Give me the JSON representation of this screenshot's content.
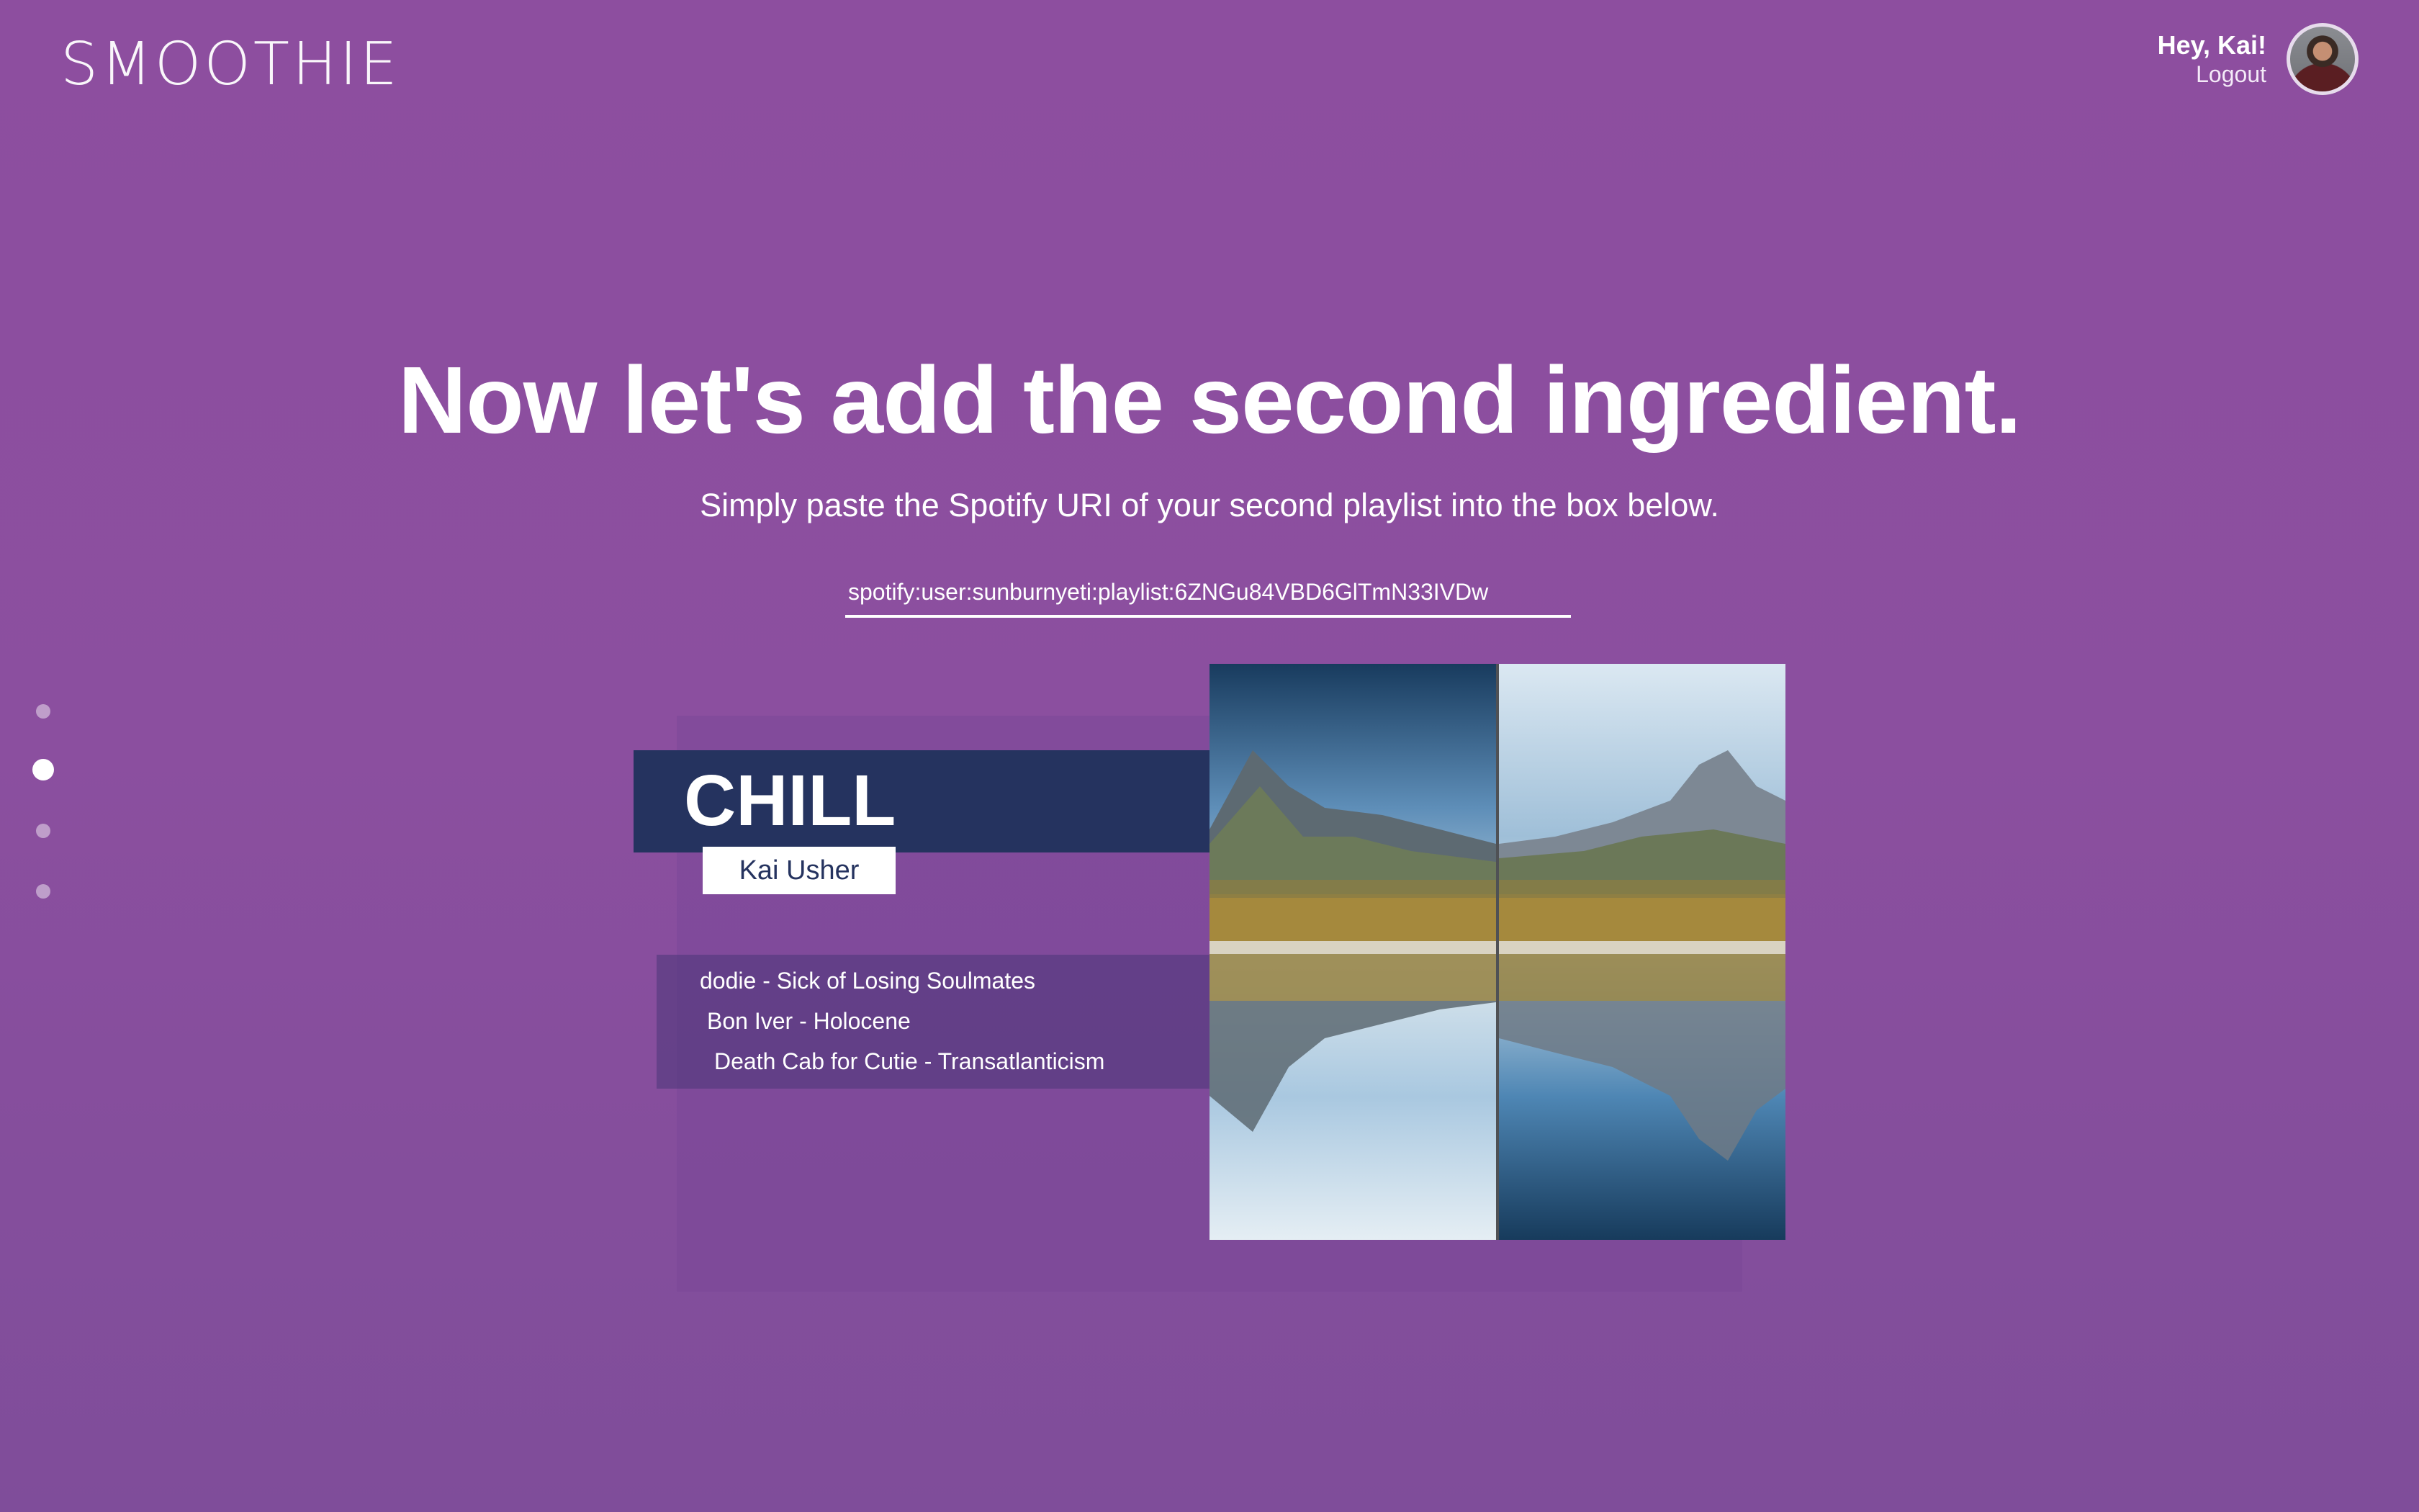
{
  "header": {
    "logo": "SMOOTHIE",
    "greeting": "Hey, Kai!",
    "logout_label": "Logout"
  },
  "main": {
    "heading": "Now let's add the second ingredient.",
    "subheading": "Simply paste the Spotify URI of your second playlist into the box below.",
    "uri_value": "spotify:user:sunburnyeti:playlist:6ZNGu84VBD6GlTmN33IVDw"
  },
  "steps": {
    "total": 4,
    "active_index": 1
  },
  "playlist": {
    "title": "CHILL",
    "owner": "Kai Usher",
    "tracks": [
      "dodie - Sick of Losing Soulmates",
      "Bon Iver - Holocene",
      "Death Cab for Cutie - Transatlanticism"
    ],
    "cover_icon": "mirrored-mountain-lake-image"
  },
  "colors": {
    "background": "#8b4f9f",
    "title_band": "#25335f",
    "text": "#ffffff"
  }
}
